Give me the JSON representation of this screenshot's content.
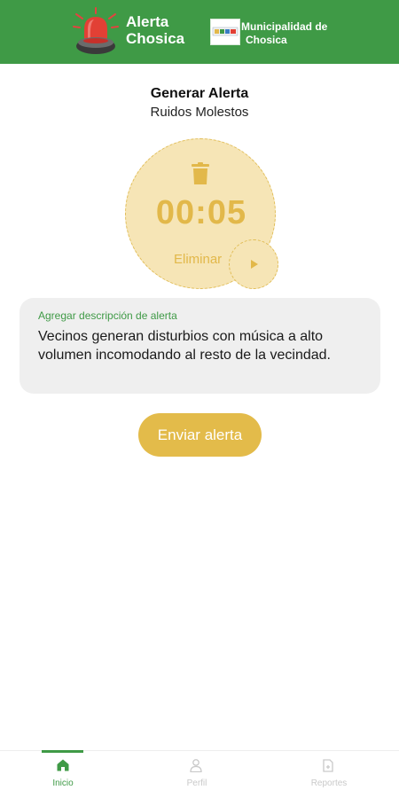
{
  "header": {
    "app_title_line1": "Alerta",
    "app_title_line2": "Chosica",
    "municipality_line1": "Municipalidad de",
    "municipality_line2": "Chosica",
    "bg_color": "#3f9a46"
  },
  "main": {
    "title": "Generar Alerta",
    "subtitle": "Ruidos Molestos"
  },
  "recorder": {
    "timer": "00:05",
    "delete_label": "Eliminar",
    "accent_color": "#e2b84a",
    "fill_color": "#f6e5b6"
  },
  "description": {
    "label": "Agregar descripción de alerta",
    "text": "Vecinos generan disturbios con música a alto volumen incomodando al resto de la vecindad."
  },
  "send_button": {
    "label": "Enviar alerta",
    "color": "#e3bb4a"
  },
  "bottom_nav": {
    "items": [
      {
        "label": "Inicio",
        "icon": "home-icon",
        "active": true
      },
      {
        "label": "Perfil",
        "icon": "user-icon",
        "active": false
      },
      {
        "label": "Reportes",
        "icon": "report-icon",
        "active": false
      }
    ]
  }
}
